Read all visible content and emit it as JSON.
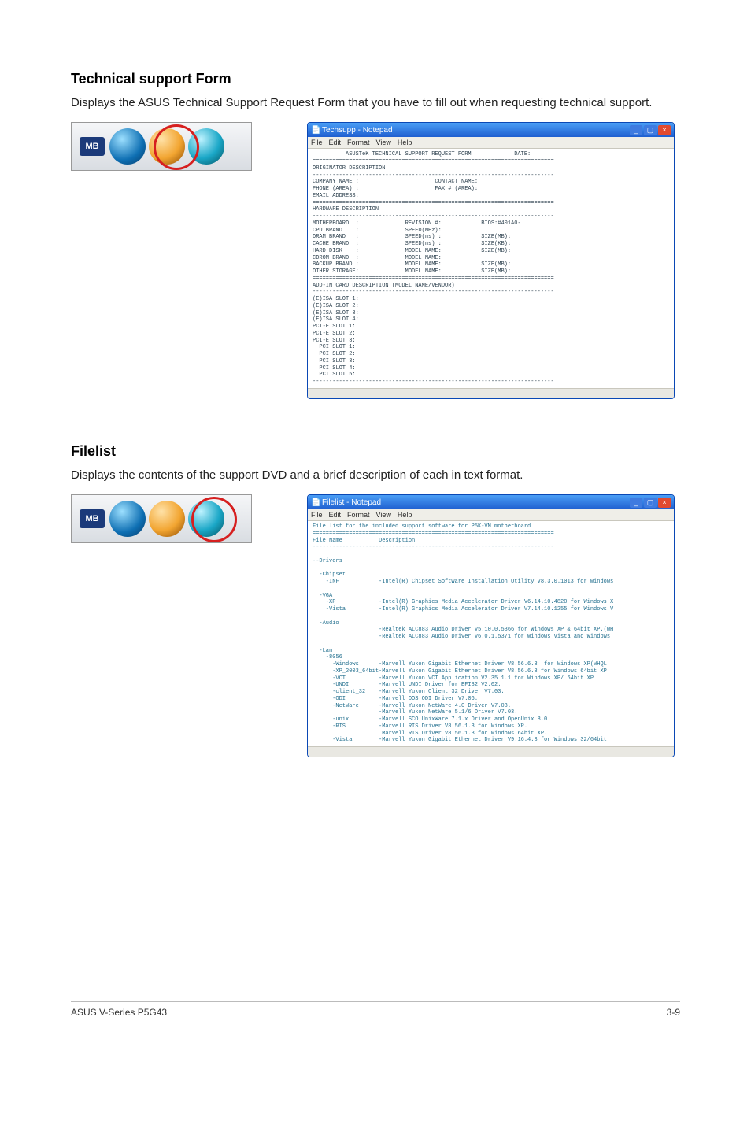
{
  "section1": {
    "heading": "Technical support Form",
    "para": "Displays the ASUS Technical Support Request Form that you have to fill out when requesting technical support."
  },
  "section2": {
    "heading": "Filelist",
    "para": "Displays the contents of the support DVD and a brief description of each in text format."
  },
  "mb_badge": "MB",
  "notepad1": {
    "title": "Techsupp - Notepad",
    "menu": [
      "File",
      "Edit",
      "Format",
      "View",
      "Help"
    ],
    "body": "          ASUSTeK TECHNICAL SUPPORT REQUEST FORM             DATE:\n=========================================================================\nORIGINATOR DESCRIPTION\n-------------------------------------------------------------------------\nCOMPANY NAME :                       CONTACT NAME:\nPHONE (AREA) :                       FAX # (AREA):\nEMAIL ADDRESS:\n=========================================================================\nHARDWARE DESCRIPTION\n-------------------------------------------------------------------------\nMOTHERBOARD  :              REVISION #:            BIOS:#401A0-\nCPU BRAND    :              SPEED(MHz):\nDRAM BRAND   :              SPEED(ns) :            SIZE(MB):\nCACHE BRAND  :              SPEED(ns) :            SIZE(KB):\nHARD DISK    :              MODEL NAME:            SIZE(MB):\nCDROM BRAND  :              MODEL NAME:\nBACKUP BRAND :              MODEL NAME:            SIZE(MB):\nOTHER STORAGE:              MODEL NAME:            SIZE(MB):\n=========================================================================\nADD-IN CARD DESCRIPTION (MODEL NAME/VENDOR)\n-------------------------------------------------------------------------\n(E)ISA SLOT 1:\n(E)ISA SLOT 2:\n(E)ISA SLOT 3:\n(E)ISA SLOT 4:\nPCI-E SLOT 1:\nPCI-E SLOT 2:\nPCI-E SLOT 3:\n  PCI SLOT 1:\n  PCI SLOT 2:\n  PCI SLOT 3:\n  PCI SLOT 4:\n  PCI SLOT 5:\n-------------------------------------------------------------------------"
  },
  "notepad2": {
    "title": "Filelist - Notepad",
    "menu": [
      "File",
      "Edit",
      "Format",
      "View",
      "Help"
    ],
    "body": "File list for the included support software for P5K-VM motherboard\n=========================================================================\nFile Name           Description\n-------------------------------------------------------------------------\n\n--Drivers\n\n  -Chipset\n    -INF            -Intel(R) Chipset Software Installation Utility V8.3.0.1013 for Windows\n\n  -VGA\n    -XP             -Intel(R) Graphics Media Accelerator Driver V6.14.10.4820 for Windows X\n    -Vista          -Intel(R) Graphics Media Accelerator Driver V7.14.10.1255 for Windows V\n\n  -Audio\n                    -Realtek ALC883 Audio Driver V5.10.0.5366 for Windows XP & 64bit XP.(WH\n                    -Realtek ALC883 Audio Driver V6.0.1.5371 for Windows Vista and Windows \n\n  -Lan\n    -8056\n      -Windows      -Marvell Yukon Gigabit Ethernet Driver V8.56.6.3  for Windows XP(WHQL\n      -XP_2003_64bit-Marvell Yukon Gigabit Ethernet Driver V8.56.6.3 for Windows 64bit XP\n      -VCT          -Marvell Yukon VCT Application V2.35 1.1 for Windows XP/ 64bit XP\n      -UNDI         -Marvell UNDI Driver for EFI32 V2.02.\n      -client_32    -Marvell Yukon Client 32 Driver V7.03.\n      -ODI          -Marvell DOS ODI Driver V7.06.\n      -NetWare      -Marvell Yukon NetWare 4.0 Driver V7.03.\n                    -Marvell Yukon NetWare 5.1/6 Driver V7.03.\n      -unix         -Marvell SCO UnixWare 7.1.x Driver and OpenUnix 8.0.\n      -RIS          -Marvell RIS Driver V8.56.1.3 for Windows XP.\n                     Marvell RIS Driver V8.56.1.3 for Windows 64bit XP.\n      -Vista        -Marvell Yukon Gigabit Ethernet Driver V9.16.4.3 for Windows 32/64bit"
  },
  "footer": {
    "left": "ASUS V-Series P5G43",
    "right": "3-9"
  }
}
